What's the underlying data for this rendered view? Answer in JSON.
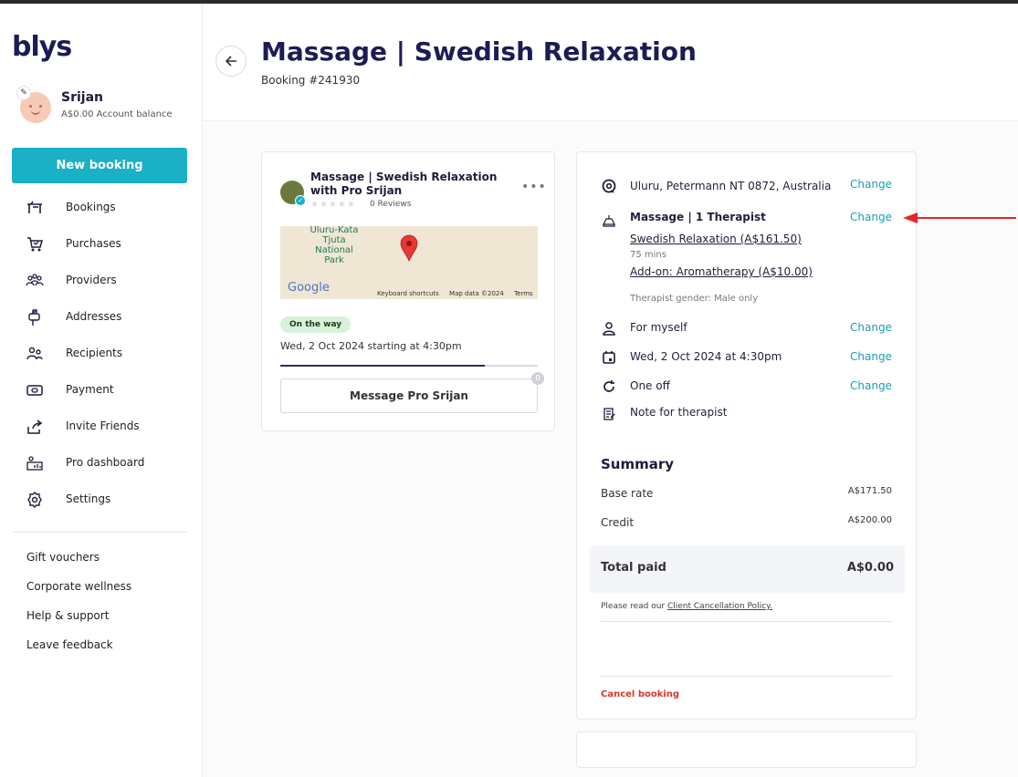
{
  "brand": {
    "logo": "blys",
    "accent": "#1ab0c6",
    "navy": "#1c1c55"
  },
  "user": {
    "name": "Srijan",
    "balance": "A$0.00 Account balance"
  },
  "sidebar": {
    "new_booking": "New booking",
    "nav": [
      {
        "label": "Bookings",
        "icon": "massage-table-icon"
      },
      {
        "label": "Purchases",
        "icon": "cart-icon"
      },
      {
        "label": "Providers",
        "icon": "providers-icon"
      },
      {
        "label": "Addresses",
        "icon": "mailbox-icon"
      },
      {
        "label": "Recipients",
        "icon": "recipients-icon"
      },
      {
        "label": "Payment",
        "icon": "payment-icon"
      },
      {
        "label": "Invite Friends",
        "icon": "share-icon"
      },
      {
        "label": "Pro dashboard",
        "icon": "dashboard-icon"
      },
      {
        "label": "Settings",
        "icon": "gear-icon"
      }
    ],
    "links": [
      "Gift vouchers",
      "Corporate wellness",
      "Help & support",
      "Leave feedback"
    ]
  },
  "header": {
    "title": "Massage | Swedish Relaxation",
    "booking_number": "Booking #241930"
  },
  "pro_card": {
    "title": "Massage | Swedish Relaxation with Pro Srijan",
    "stars": "★★★★★",
    "reviews": "0 Reviews",
    "map": {
      "place": "Uluru-Kata Tjuta National Park",
      "google": "Google",
      "footer": [
        "Keyboard shortcuts",
        "Map data ©2024",
        "Terms"
      ]
    },
    "status": "On the way",
    "date": "Wed, 2 Oct 2024 starting at 4:30pm",
    "progress": 0.796,
    "message_button": "Message Pro Srijan",
    "message_count": "0"
  },
  "details": {
    "address": "Uluru, Petermann NT 0872, Australia",
    "service": "Massage | 1 Therapist",
    "treatment": "Swedish Relaxation (A$161.50)",
    "duration": "75 mins",
    "addon": "Add-on: Aromatherapy (A$10.00)",
    "gender": "Therapist gender: Male only",
    "recipient": "For myself",
    "datetime": "Wed, 2 Oct 2024 at 4:30pm",
    "frequency": "One off",
    "note": "Note for therapist",
    "change_label": "Change"
  },
  "summary": {
    "title": "Summary",
    "base_rate_label": "Base rate",
    "base_rate": "A$171.50",
    "credit_label": "Credit",
    "credit": "A$200.00",
    "total_label": "Total paid",
    "total": "A$0.00",
    "policy_prefix": "Please read our",
    "policy_link": "Client Cancellation Policy.",
    "cancel": "Cancel booking"
  },
  "annotation": {
    "color": "#e0262b"
  }
}
